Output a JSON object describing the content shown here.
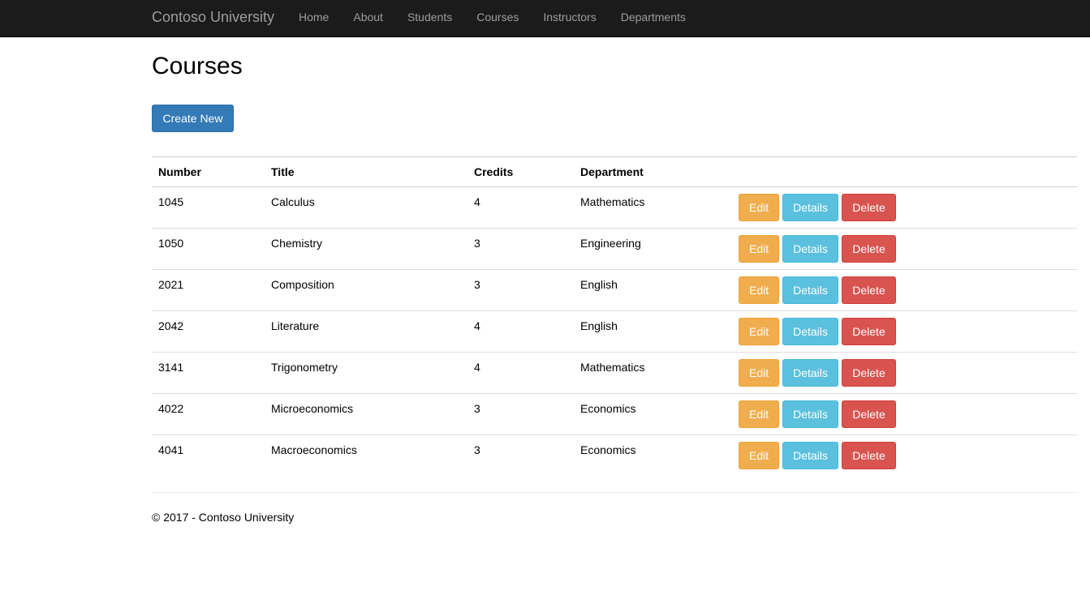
{
  "navbar": {
    "brand": "Contoso University",
    "links": [
      {
        "label": "Home"
      },
      {
        "label": "About"
      },
      {
        "label": "Students"
      },
      {
        "label": "Courses"
      },
      {
        "label": "Instructors"
      },
      {
        "label": "Departments"
      }
    ]
  },
  "page": {
    "title": "Courses",
    "create_label": "Create New"
  },
  "table": {
    "headers": [
      "Number",
      "Title",
      "Credits",
      "Department"
    ],
    "action_labels": {
      "edit": "Edit",
      "details": "Details",
      "delete": "Delete"
    },
    "rows": [
      {
        "number": "1045",
        "title": "Calculus",
        "credits": "4",
        "department": "Mathematics"
      },
      {
        "number": "1050",
        "title": "Chemistry",
        "credits": "3",
        "department": "Engineering"
      },
      {
        "number": "2021",
        "title": "Composition",
        "credits": "3",
        "department": "English"
      },
      {
        "number": "2042",
        "title": "Literature",
        "credits": "4",
        "department": "English"
      },
      {
        "number": "3141",
        "title": "Trigonometry",
        "credits": "4",
        "department": "Mathematics"
      },
      {
        "number": "4022",
        "title": "Microeconomics",
        "credits": "3",
        "department": "Economics"
      },
      {
        "number": "4041",
        "title": "Macroeconomics",
        "credits": "3",
        "department": "Economics"
      }
    ]
  },
  "footer": {
    "text": "© 2017 - Contoso University"
  },
  "colors": {
    "navbar_bg": "#1b1b1b",
    "primary": "#337ab7",
    "warning": "#f0ad4e",
    "info": "#5bc0de",
    "danger": "#d9534f"
  }
}
